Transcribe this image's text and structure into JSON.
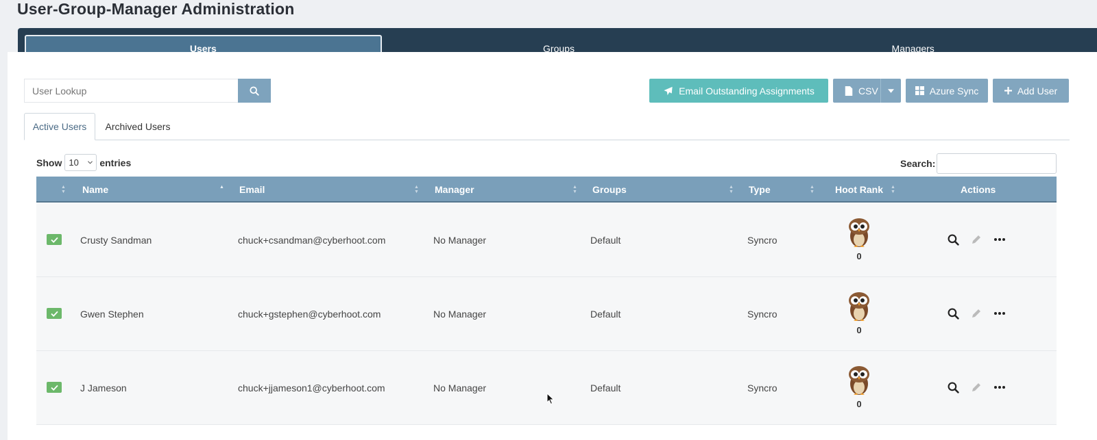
{
  "page": {
    "title": "User-Group-Manager Administration"
  },
  "main_tabs": [
    {
      "label": "Users",
      "active": true
    },
    {
      "label": "Groups",
      "active": false
    },
    {
      "label": "Managers",
      "active": false
    }
  ],
  "lookup": {
    "placeholder": "User Lookup"
  },
  "toolbar": {
    "email_label": "Email Outstanding Assignments",
    "csv_label": "CSV",
    "azure_label": "Azure Sync",
    "add_label": "Add User"
  },
  "subtabs": {
    "active_label": "Active Users",
    "archived_label": "Archived Users"
  },
  "table_controls": {
    "show_label": "Show",
    "entries_value": "10",
    "entries_label": "entries",
    "search_label": "Search:"
  },
  "columns": {
    "name": "Name",
    "email": "Email",
    "manager": "Manager",
    "groups": "Groups",
    "type": "Type",
    "rank": "Hoot Rank",
    "actions": "Actions"
  },
  "rows": [
    {
      "name": "Crusty Sandman",
      "email": "chuck+csandman@cyberhoot.com",
      "manager": "No Manager",
      "groups": "Default",
      "type": "Syncro",
      "rank": "0"
    },
    {
      "name": "Gwen Stephen",
      "email": "chuck+gstephen@cyberhoot.com",
      "manager": "No Manager",
      "groups": "Default",
      "type": "Syncro",
      "rank": "0"
    },
    {
      "name": "J Jameson",
      "email": "chuck+jjameson1@cyberhoot.com",
      "manager": "No Manager",
      "groups": "Default",
      "type": "Syncro",
      "rank": "0"
    }
  ],
  "colors": {
    "nav_bg": "#263e52",
    "header_bg": "#7a9fba",
    "teal": "#5ebdbb",
    "check_green": "#6cb86a"
  },
  "icons": [
    "search-icon",
    "paper-plane-icon",
    "file-icon",
    "caret-down-icon",
    "windows-icon",
    "plus-icon",
    "check-icon",
    "owl-icon",
    "magnifier-icon",
    "pencil-icon",
    "ellipsis-icon"
  ]
}
